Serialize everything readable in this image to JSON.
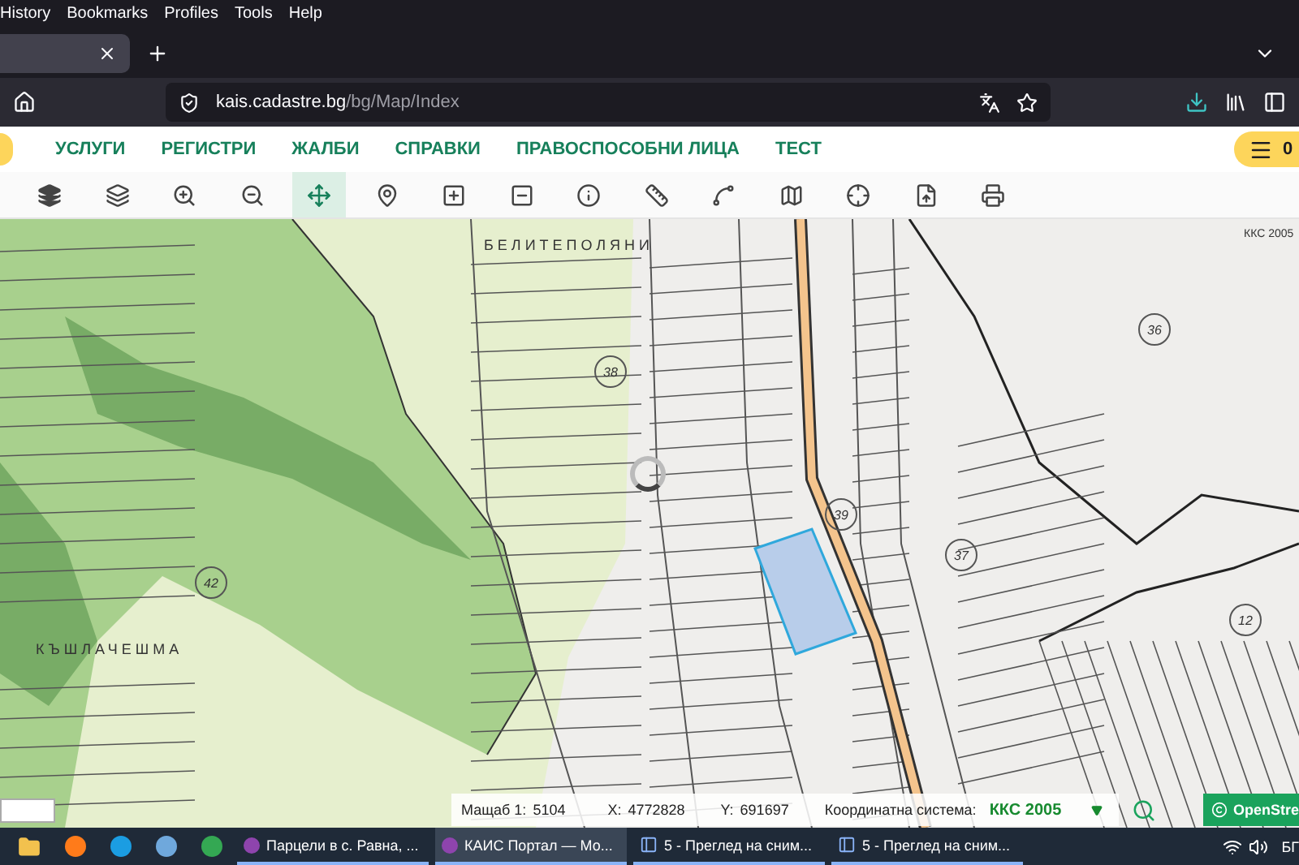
{
  "browser_menu": [
    "History",
    "Bookmarks",
    "Profiles",
    "Tools",
    "Help"
  ],
  "address_bar": {
    "url_host": "kais.cadastre.bg",
    "url_path": "/bg/Map/Index"
  },
  "site_nav": {
    "items": [
      {
        "label": "УСЛУГИ"
      },
      {
        "label": "РЕГИСТРИ"
      },
      {
        "label": "ЖАЛБИ"
      },
      {
        "label": "СПРАВКИ"
      },
      {
        "label": "ПРАВОСПОСОБНИ ЛИЦА"
      },
      {
        "label": "ТЕСТ"
      }
    ],
    "menu_count": "0"
  },
  "map_toolbar": [
    {
      "kind": "base-layers",
      "selected": false
    },
    {
      "kind": "layers",
      "selected": false
    },
    {
      "kind": "zoom-in",
      "selected": false
    },
    {
      "kind": "zoom-out",
      "selected": false
    },
    {
      "kind": "pan",
      "selected": true
    },
    {
      "kind": "marker",
      "selected": false
    },
    {
      "kind": "draw-rect",
      "selected": false
    },
    {
      "kind": "erase-rect",
      "selected": false
    },
    {
      "kind": "info",
      "selected": false
    },
    {
      "kind": "measure",
      "selected": false
    },
    {
      "kind": "polygon",
      "selected": false
    },
    {
      "kind": "map",
      "selected": false
    },
    {
      "kind": "crosshair",
      "selected": false
    },
    {
      "kind": "export",
      "selected": false
    },
    {
      "kind": "print",
      "selected": false
    }
  ],
  "map": {
    "place_labels": [
      "БЕЛИТЕПОЛЯНИ",
      "КЪШЛАЧЕШМА",
      "ККС 2005"
    ],
    "area_numbers": [
      "36",
      "38",
      "39",
      "37",
      "12",
      "42"
    ]
  },
  "status_bar": {
    "scale": {
      "label": "Мащаб 1:",
      "value": "5104"
    },
    "x": {
      "label": "X:",
      "value": "4772828"
    },
    "y": {
      "label": "Y:",
      "value": "691697"
    },
    "crs": {
      "label": "Координатна система:",
      "value": "ККС 2005"
    },
    "attribution": "OpenStre"
  },
  "taskbar": {
    "tasks": [
      {
        "title": "Парцели в с. Равна, ...",
        "kind": "browser",
        "selected": false
      },
      {
        "title": "КАИС Портал — Мо...",
        "kind": "browser",
        "selected": true
      },
      {
        "title": "5 - Преглед на сним...",
        "kind": "viewer",
        "selected": false
      },
      {
        "title": "5 - Преглед на сним...",
        "kind": "viewer",
        "selected": false
      }
    ],
    "language": "БГ"
  }
}
